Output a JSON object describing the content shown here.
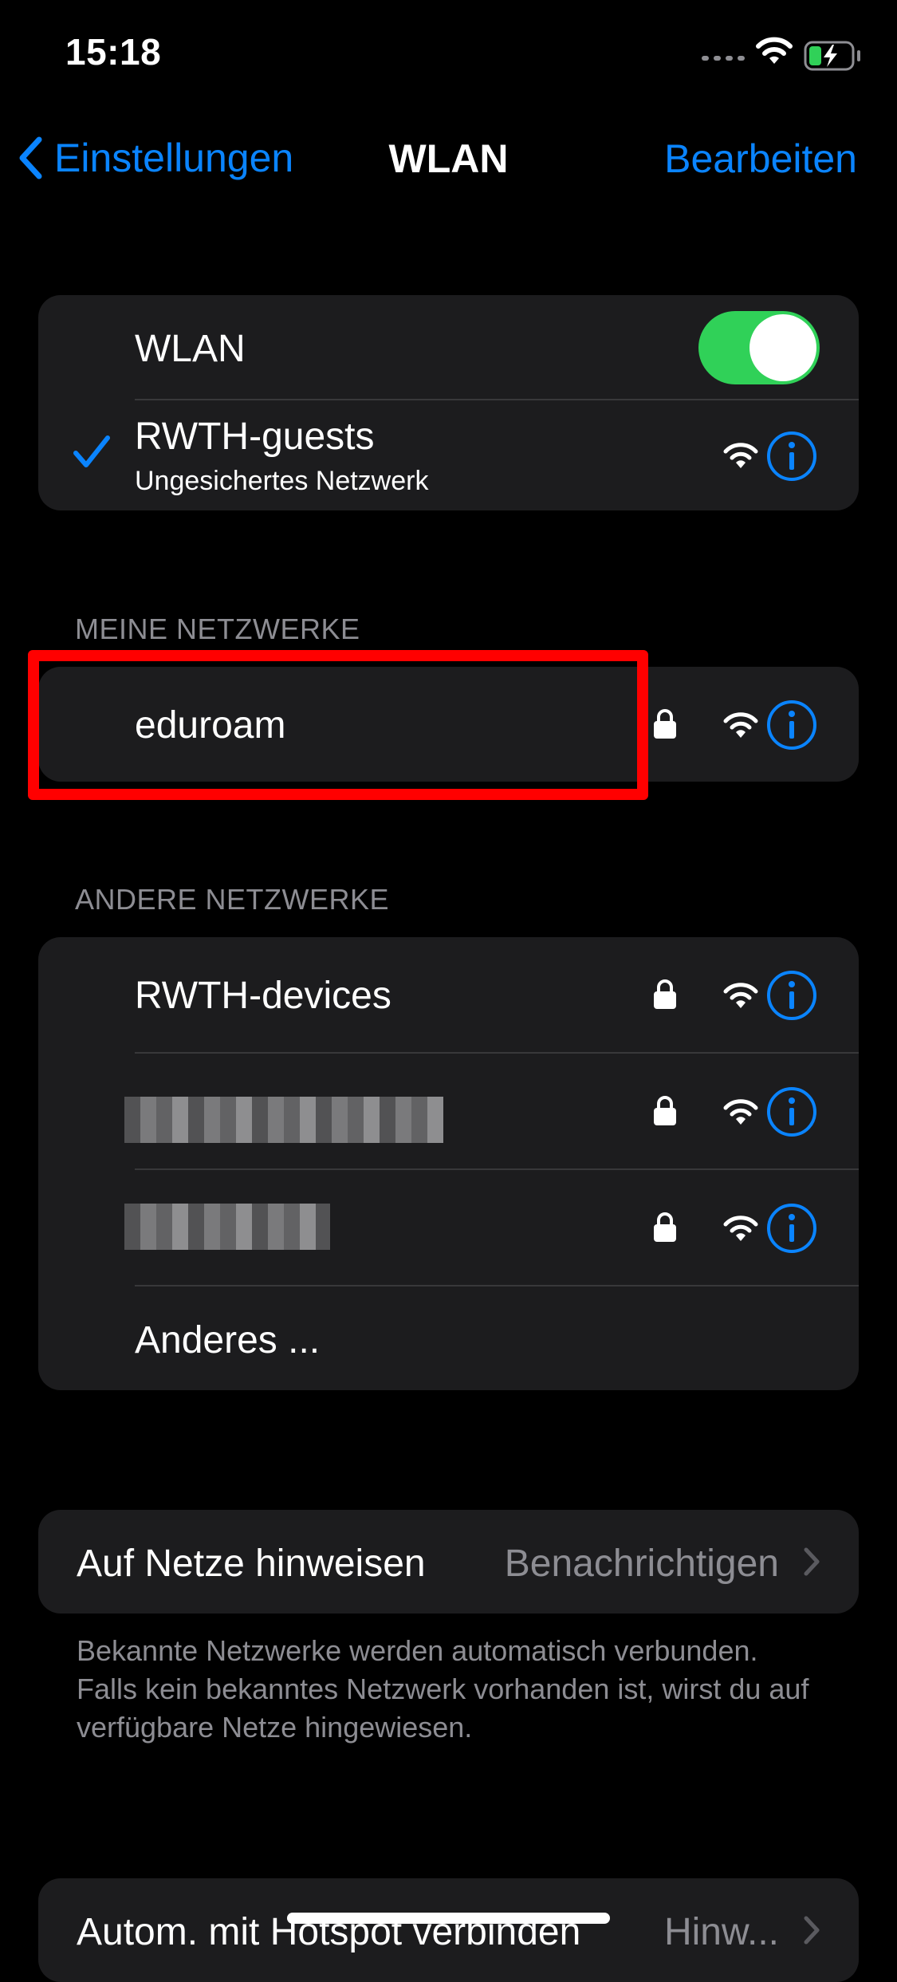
{
  "status_bar": {
    "time": "15:18",
    "battery_icon": "battery-charging-icon",
    "wifi_icon": "wifi-icon"
  },
  "nav": {
    "back_label": "Einstellungen",
    "title": "WLAN",
    "edit_label": "Bearbeiten"
  },
  "wlan_group": {
    "toggle_label": "WLAN",
    "toggle_on": true,
    "connected": {
      "name": "RWTH-guests",
      "subtitle": "Ungesichertes Netzwerk"
    }
  },
  "my_networks": {
    "header": "MEINE NETZWERKE",
    "items": [
      {
        "name": "eduroam",
        "locked": true
      }
    ]
  },
  "other_networks": {
    "header": "ANDERE NETZWERKE",
    "items": [
      {
        "name": "RWTH-devices",
        "locked": true
      },
      {
        "name": "",
        "locked": true,
        "redacted": true
      },
      {
        "name": "",
        "locked": true,
        "redacted": true
      }
    ],
    "other_label": "Anderes ..."
  },
  "ask_to_join": {
    "label": "Auf Netze hinweisen",
    "value": "Benachrichtigen",
    "footer": "Bekannte Netzwerke werden automatisch verbunden. Falls kein bekanntes Netzwerk vorhanden ist, wirst du auf verfügbare Netze hingewiesen."
  },
  "hotspot": {
    "label": "Autom. mit Hotspot verbinden",
    "value": "Hinw..."
  },
  "colors": {
    "accent": "#0a84ff",
    "toggle_on": "#30d158",
    "highlight": "#ff0000",
    "group_bg": "#1c1c1e"
  }
}
